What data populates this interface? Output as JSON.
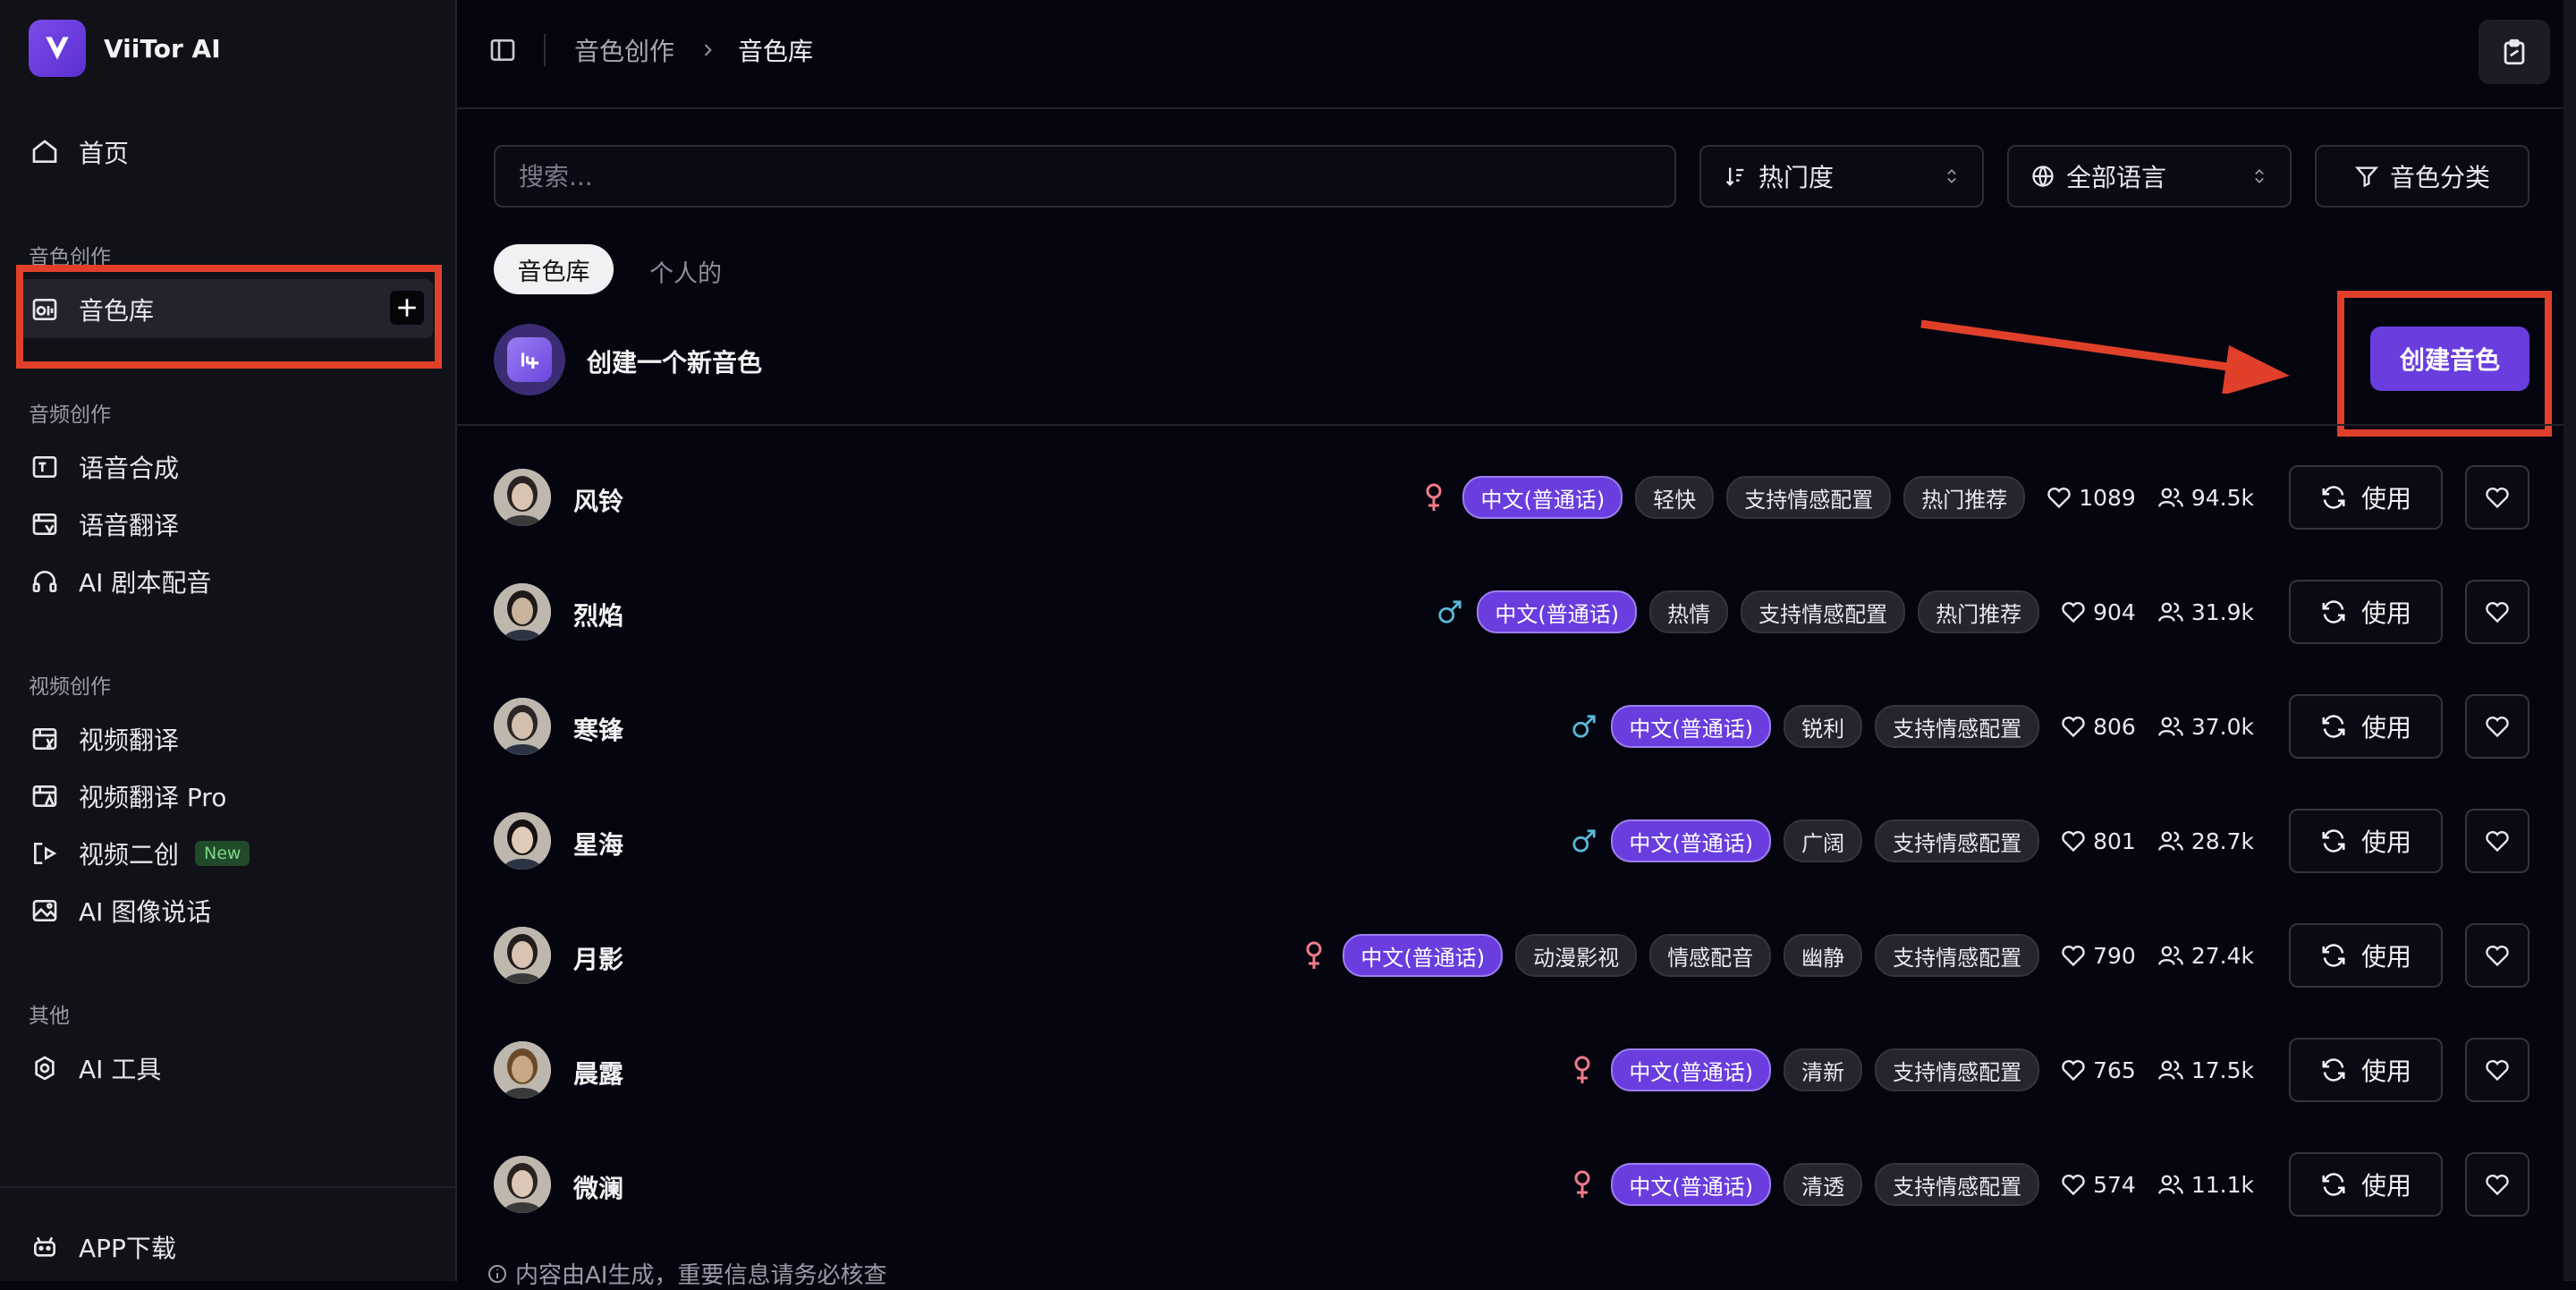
{
  "app": {
    "name": "ViiTor AI",
    "logo_letter": "V"
  },
  "sidebar": {
    "home": {
      "label": "首页",
      "icon": "home-icon"
    },
    "sections": [
      {
        "label": "音色创作",
        "items": [
          {
            "label": "音色库",
            "icon": "voice-library-icon",
            "active": true
          }
        ]
      },
      {
        "label": "音频创作",
        "items": [
          {
            "label": "语音合成",
            "icon": "speech-synthesis-icon"
          },
          {
            "label": "语音翻译",
            "icon": "speech-translate-icon"
          },
          {
            "label": "AI 剧本配音",
            "icon": "headset-icon"
          }
        ]
      },
      {
        "label": "视频创作",
        "items": [
          {
            "label": "视频翻译",
            "icon": "video-translate-icon"
          },
          {
            "label": "视频翻译 Pro",
            "icon": "video-translate-pro-icon"
          },
          {
            "label": "视频二创",
            "icon": "video-remix-icon",
            "badge": "New"
          },
          {
            "label": "AI 图像说话",
            "icon": "image-talk-icon"
          }
        ]
      },
      {
        "label": "其他",
        "items": [
          {
            "label": "AI 工具",
            "icon": "ai-tools-icon"
          }
        ]
      }
    ],
    "footer": {
      "label": "APP下载",
      "icon": "app-download-icon"
    }
  },
  "header": {
    "breadcrumb": [
      "音色创作",
      "音色库"
    ]
  },
  "filters": {
    "search_placeholder": "搜索...",
    "sort": "热门度",
    "language": "全部语言",
    "category_button": "音色分类"
  },
  "tabs": {
    "library": "音色库",
    "personal": "个人的"
  },
  "create": {
    "label": "创建一个新音色",
    "button": "创建音色"
  },
  "row_action": {
    "use": "使用"
  },
  "colors": {
    "accent": "#6a3ddf",
    "female": "#f07a8a",
    "male": "#5ab8d8",
    "annotation": "#e0402a"
  },
  "voices": [
    {
      "name": "风铃",
      "gender": "female",
      "tags": [
        "中文(普通话)",
        "轻快",
        "支持情感配置",
        "热门推荐"
      ],
      "likes": "1089",
      "users": "94.5k"
    },
    {
      "name": "烈焰",
      "gender": "male",
      "tags": [
        "中文(普通话)",
        "热情",
        "支持情感配置",
        "热门推荐"
      ],
      "likes": "904",
      "users": "31.9k"
    },
    {
      "name": "寒锋",
      "gender": "male",
      "tags": [
        "中文(普通话)",
        "锐利",
        "支持情感配置"
      ],
      "likes": "806",
      "users": "37.0k"
    },
    {
      "name": "星海",
      "gender": "male",
      "tags": [
        "中文(普通话)",
        "广阔",
        "支持情感配置"
      ],
      "likes": "801",
      "users": "28.7k"
    },
    {
      "name": "月影",
      "gender": "female",
      "tags": [
        "中文(普通话)",
        "动漫影视",
        "情感配音",
        "幽静",
        "支持情感配置"
      ],
      "likes": "790",
      "users": "27.4k"
    },
    {
      "name": "晨露",
      "gender": "female",
      "tags": [
        "中文(普通话)",
        "清新",
        "支持情感配置"
      ],
      "likes": "765",
      "users": "17.5k"
    },
    {
      "name": "微澜",
      "gender": "female",
      "tags": [
        "中文(普通话)",
        "清透",
        "支持情感配置"
      ],
      "likes": "574",
      "users": "11.1k"
    }
  ],
  "notice": "内容由AI生成，重要信息请务必核查"
}
